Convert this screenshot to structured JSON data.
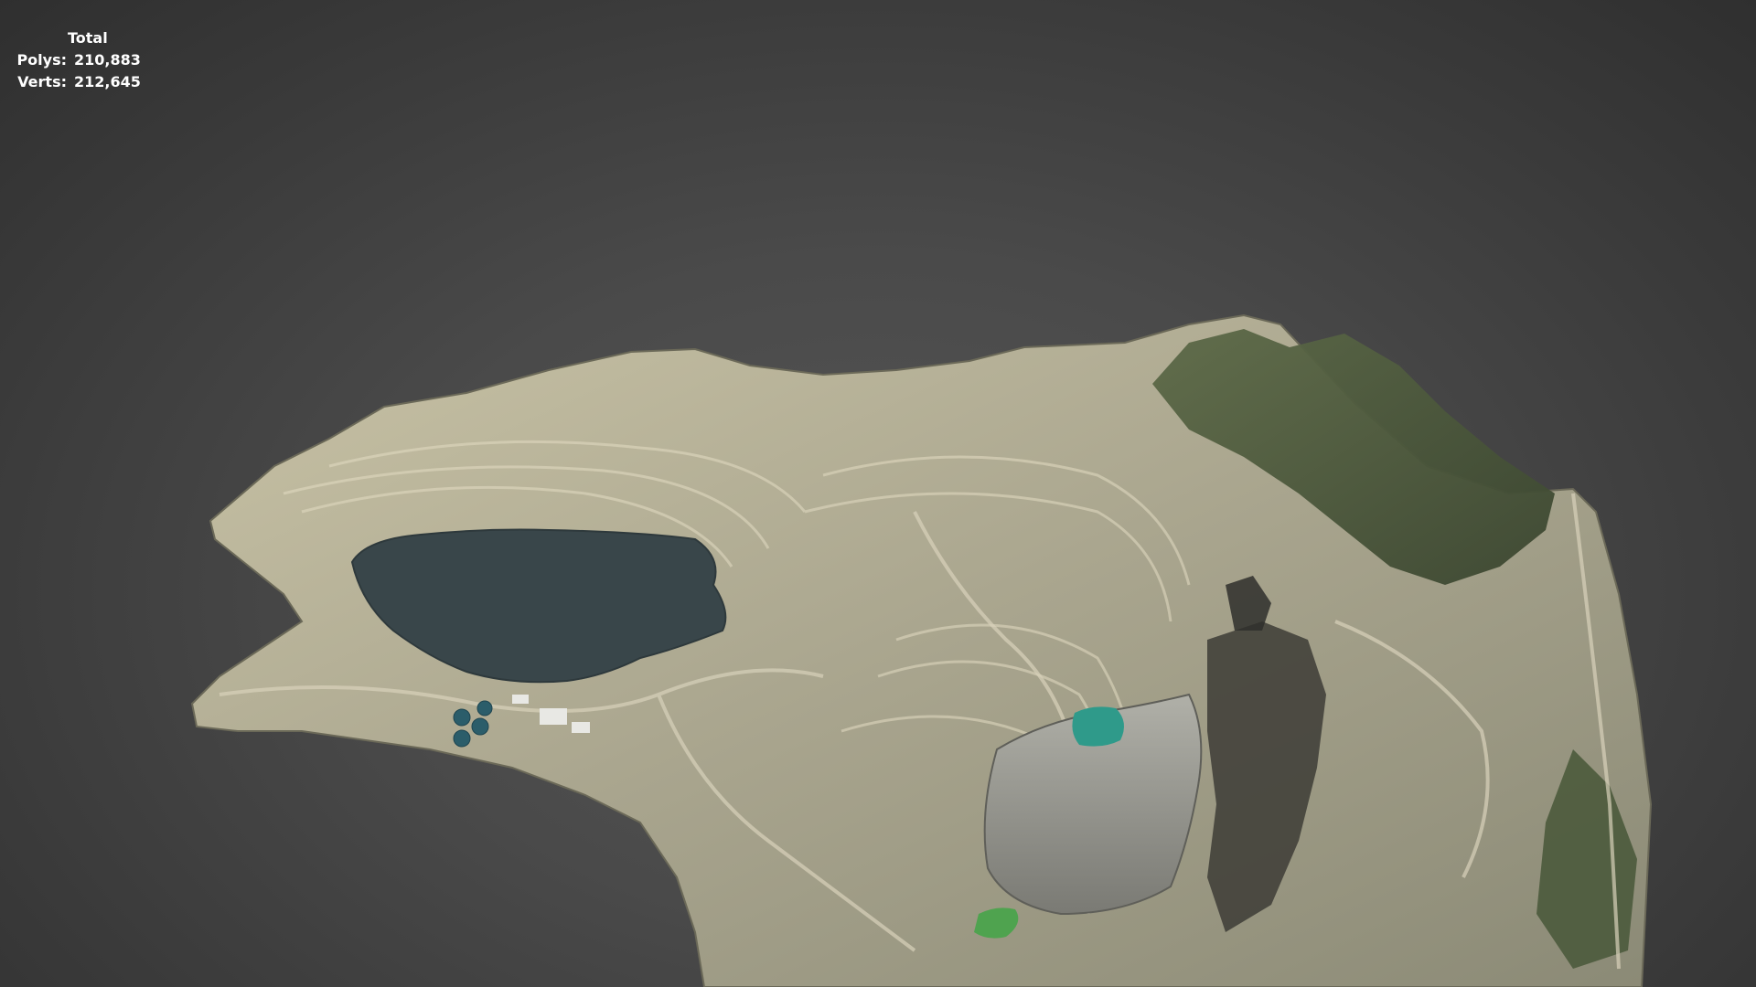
{
  "viewport": {
    "stats_title": "Total",
    "stats": [
      {
        "label": "Polys:",
        "value": "210,883"
      },
      {
        "label": "Verts:",
        "value": "212,645"
      }
    ]
  },
  "colors": {
    "background": "#484848",
    "stats_text": "#ffffff",
    "pit_lake": "#39464a",
    "terrain_rock": "#b8b39a",
    "vegetation": "#4b5a3c"
  },
  "scene": {
    "object": "open-pit-mine-terrain-model"
  }
}
